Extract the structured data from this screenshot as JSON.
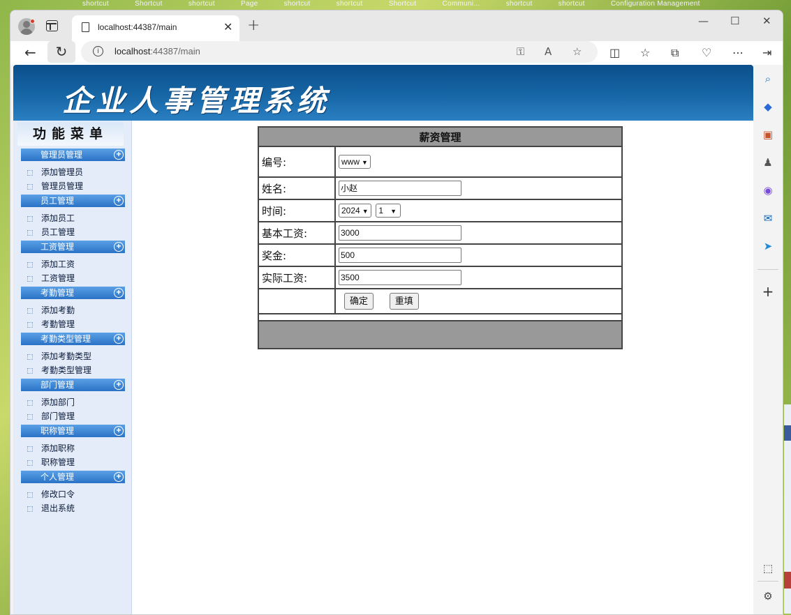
{
  "desktop": {
    "top_labels": [
      "shortcut",
      "Shortcut",
      "shortcut",
      "Page",
      "shortcut",
      "shortcut",
      "Shortcut",
      "Communi...",
      "shortcut",
      "shortcut",
      "Configuration Management"
    ]
  },
  "browser": {
    "tab_title": "localhost:44387/main",
    "url_host": "localhost",
    "url_rest": ":44387/main",
    "icons": {
      "profile": "profile-avatar-icon",
      "tab_actions": "tab-actions-icon",
      "close_tab": "close-icon",
      "new_tab": "plus-icon",
      "back": "back-arrow-icon",
      "refresh": "refresh-icon",
      "site_info": "info-icon",
      "password": "key-icon",
      "read_aloud": "read-aloud-icon",
      "favorite": "star-icon"
    },
    "window_controls": [
      "minimize",
      "maximize",
      "close"
    ]
  },
  "banner": {
    "title": "企业人事管理系统"
  },
  "sidebar": {
    "header": "功能菜单",
    "groups": [
      {
        "label": "管理员管理",
        "items": [
          "添加管理员",
          "管理员管理"
        ]
      },
      {
        "label": "员工管理",
        "items": [
          "添加员工",
          "员工管理"
        ]
      },
      {
        "label": "工资管理",
        "items": [
          "添加工资",
          "工资管理"
        ]
      },
      {
        "label": "考勤管理",
        "items": [
          "添加考勤",
          "考勤管理"
        ]
      },
      {
        "label": "考勤类型管理",
        "items": [
          "添加考勤类型",
          "考勤类型管理"
        ]
      },
      {
        "label": "部门管理",
        "items": [
          "添加部门",
          "部门管理"
        ]
      },
      {
        "label": "职称管理",
        "items": [
          "添加职称",
          "职称管理"
        ]
      },
      {
        "label": "个人管理",
        "items": [
          "修改口令",
          "退出系统"
        ]
      }
    ]
  },
  "form": {
    "title": "薪资管理",
    "id_label": "编号:",
    "id_value": "www",
    "name_label": "姓名:",
    "name_value": "小赵",
    "time_label": "时间:",
    "year_value": "2024",
    "month_value": "1",
    "base_label": "基本工资:",
    "base_value": "3000",
    "bonus_label": "奖金:",
    "bonus_value": "500",
    "actual_label": "实际工资:",
    "actual_value": "3500",
    "submit_label": "确定",
    "reset_label": "重填"
  },
  "colors": {
    "banner": "#1766a6",
    "group_bar": "#2a72c6",
    "sidebar_bg": "#e3ecf8",
    "table_header": "#999999"
  }
}
